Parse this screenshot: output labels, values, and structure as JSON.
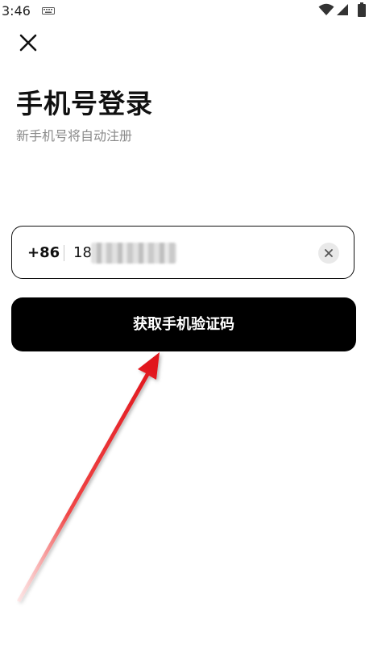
{
  "status_bar": {
    "time": "3:46",
    "keyboard_icon": "keyboard-icon",
    "wifi_icon": "wifi-icon",
    "signal_icon": "signal-icon",
    "battery_icon": "battery-icon"
  },
  "header": {
    "close_icon": "close-icon",
    "title": "手机号登录",
    "subtitle": "新手机号将自动注册"
  },
  "phone_input": {
    "country_code": "+86",
    "value_visible_prefix": "18",
    "clear_icon": "clear-icon"
  },
  "actions": {
    "get_code_label": "获取手机验证码"
  },
  "colors": {
    "primary_button": "#000000",
    "button_text": "#ffffff",
    "subtitle": "#8a8a8a",
    "annotation_arrow": "#e0141b"
  }
}
